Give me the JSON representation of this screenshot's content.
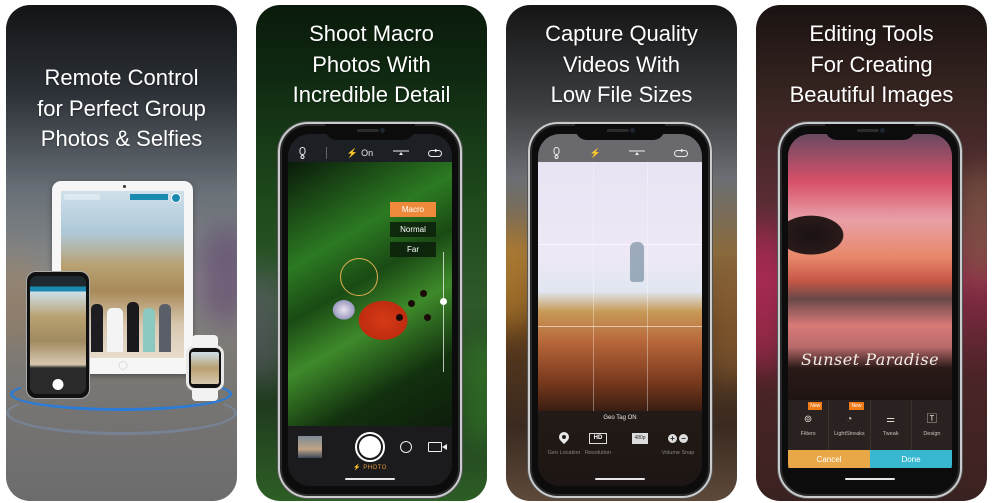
{
  "panels": [
    {
      "id": "remote-control",
      "headline": [
        "Remote Control",
        "for Perfect Group",
        "Photos & Selfies"
      ],
      "devices": [
        "ipad",
        "iphone",
        "apple-watch"
      ]
    },
    {
      "id": "macro",
      "headline": [
        "Shoot Macro",
        "Photos With",
        "Incredible Detail"
      ],
      "camera_topbar": {
        "icons": [
          "remote-icon",
          "flash-icon",
          "exposure-icon",
          "flip-camera-icon"
        ],
        "flash_label": "On"
      },
      "focus_options": [
        {
          "label": "Macro",
          "active": true
        },
        {
          "label": "Normal",
          "active": false
        },
        {
          "label": "Far",
          "active": false
        }
      ],
      "mode_label": "PHOTO",
      "accent_color": "#ef8a3c"
    },
    {
      "id": "video",
      "headline": [
        "Capture Quality",
        "Videos With",
        "Low File Sizes"
      ],
      "camera_topbar": {
        "icons": [
          "remote-icon",
          "flash-icon",
          "exposure-icon",
          "flip-camera-icon"
        ]
      },
      "geotag_status": "Geo Tag ON",
      "controls": [
        {
          "icon": "pin-icon",
          "label": "Geo Location"
        },
        {
          "icon": "hd-icon",
          "badge": "HD",
          "label": "Resolution"
        },
        {
          "icon": "resolution-icon",
          "badge": "480p",
          "label": ""
        },
        {
          "icon": "volume-icon",
          "label": "Volume Snap"
        }
      ]
    },
    {
      "id": "editing",
      "headline": [
        "Editing Tools",
        "For Creating",
        "Beautiful Images"
      ],
      "overlay_text": "Sunset Paradise",
      "tools": [
        {
          "label": "Filters",
          "badge": "New"
        },
        {
          "label": "LightStreaks",
          "badge": "New"
        },
        {
          "label": "Tweak",
          "badge": ""
        },
        {
          "label": "Design",
          "badge": ""
        }
      ],
      "cancel_label": "Cancel",
      "done_label": "Done",
      "cancel_color": "#e8a848",
      "done_color": "#38b8d0"
    }
  ]
}
